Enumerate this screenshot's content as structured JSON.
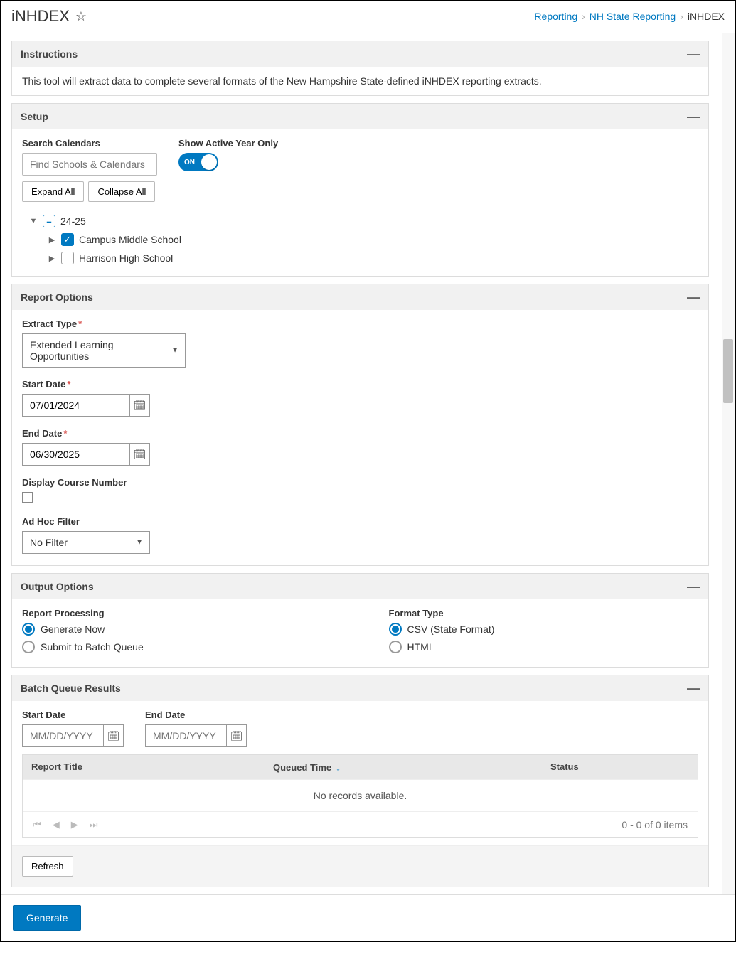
{
  "header": {
    "title": "iNHDEX",
    "breadcrumbs": {
      "items": [
        "Reporting",
        "NH State Reporting"
      ],
      "current": "iNHDEX"
    }
  },
  "instructions": {
    "title": "Instructions",
    "body": "This tool will extract data to complete several formats of the New Hampshire State-defined iNHDEX reporting extracts."
  },
  "setup": {
    "title": "Setup",
    "search_label": "Search Calendars",
    "search_placeholder": "Find Schools & Calendars",
    "active_year_label": "Show Active Year Only",
    "toggle_text": "ON",
    "expand_all": "Expand All",
    "collapse_all": "Collapse All",
    "tree": {
      "year": "24-25",
      "schools": [
        {
          "name": "Campus Middle School",
          "checked": true
        },
        {
          "name": "Harrison High School",
          "checked": false
        }
      ]
    }
  },
  "report_options": {
    "title": "Report Options",
    "extract_type_label": "Extract Type",
    "extract_type_value": "Extended Learning Opportunities",
    "start_date_label": "Start Date",
    "start_date_value": "07/01/2024",
    "end_date_label": "End Date",
    "end_date_value": "06/30/2025",
    "display_course_label": "Display Course Number",
    "adhoc_label": "Ad Hoc Filter",
    "adhoc_value": "No Filter"
  },
  "output_options": {
    "title": "Output Options",
    "processing_label": "Report Processing",
    "processing_opts": [
      "Generate Now",
      "Submit to Batch Queue"
    ],
    "format_label": "Format Type",
    "format_opts": [
      "CSV  (State Format)",
      "HTML"
    ]
  },
  "batch_queue": {
    "title": "Batch Queue Results",
    "start_date_label": "Start Date",
    "end_date_label": "End Date",
    "date_placeholder": "MM/DD/YYYY",
    "columns": {
      "title": "Report Title",
      "queued": "Queued Time",
      "status": "Status"
    },
    "empty_text": "No records available.",
    "pager_text": "0 - 0 of 0 items",
    "refresh": "Refresh"
  },
  "footer": {
    "generate": "Generate"
  }
}
